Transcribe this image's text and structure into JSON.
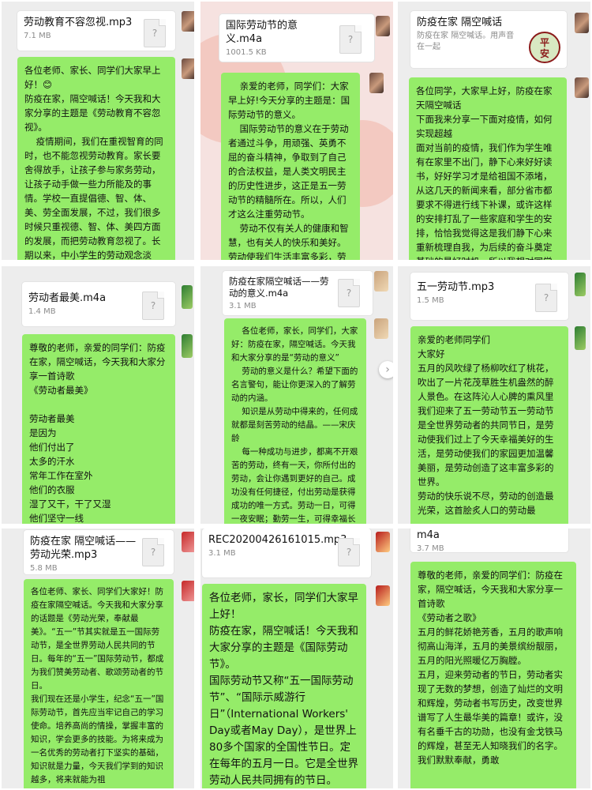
{
  "panels": [
    {
      "file_name": "劳动教育不容忽视.mp3",
      "file_size": "7.1 MB",
      "bubble": "各位老师、家长、同学们大家早上好！😊\n防疫在家，隔空喊话！今天我和大家分享的主题是《劳动教育不容忽视》。\n    疫情期间，我们在重视智育的同时，也不能忽视劳动教育。家长要舍得放手，让孩子参与家务劳动，让孩子动手做一些力所能及的事情。学校一直提倡德、智、体、美、劳全面发展，不过，我们很多时候只重视德、智、体、美四方面的发展，而把劳动教育忽视了。长期以来，中小学生的劳动观念淡薄，劳动技能较低，"
    },
    {
      "file_name": "国际劳动节的意义.m4a",
      "file_size": "1001.5 KB",
      "bubble": "    亲爱的老师，同学们：大家早上好!今天分享的主题是：国际劳动节的意义。\n    国际劳动节的意义在于劳动者通过斗争，用顽强、英勇不屈的奋斗精神，争取到了自己的合法权益，是人类文明民主的历史性进步，这正是五一劳动节的精髓所在。所以，人们才这么注重劳动节。\n    劳动不仅有关人的健康和智慧，也有关人的快乐和美好。劳动使我们生活丰富多彩，劳动"
    },
    {
      "file_name": "防疫在家 隔空喊话",
      "file_desc": "防疫在家 隔空喊话。用声音在一起",
      "thumb_text": "平\n安",
      "bubble": "各位同学，大家早上好，防疫在家\n天隔空喊话\n下面我来分享一下面对疫情，如何实现超越\n面对当前的疫情，我们作为学生唯有在家里不出门，静下心来好好读书，好好学习才是给祖国不添堵，从这几天的新闻来看，部分省市都要求不得进行线下补课，或许这样的安排打乱了一些家庭和学生的安排，恰恰我觉得这是我们静下心来重新梳理自我，为后续的奋斗奠定基础的最好时机，所以我想对同学"
    },
    {
      "file_name": "劳动者最美.m4a",
      "file_size": "1.4 MB",
      "bubble": "尊敬的老师，亲爱的同学们：防疫在家，隔空喊话，今天我和大家分享一首诗歌\n《劳动者最美》\n\n劳动者最美\n是因为\n他们付出了\n太多的汗水\n常年工作在室外\n他们的衣服\n湿了又干，干了又湿\n他们坚守一线\n无论刮风下雨"
    },
    {
      "file_name": "防疫在家隔空喊话——劳动的意义.m4a",
      "file_size": "3.1 MB",
      "bubble": "    各位老师，家长，同学们，大家好：防疫在家，隔空喊话。今天我和大家分享的是“劳动的意义”\n    劳动的意义是什么？希望下面的名言警句，能让你更深入的了解劳动的内涵。\n    知识是从劳动中得来的，任何成就都是刻苦劳动的结晶。——宋庆龄\n    每一种成功与进步，都离不开艰苦的劳动，终有一天，你所付出的劳动，会让你遇到更好的自己。成功没有任何捷径，付出劳动是获得成功的唯一方式。劳动一日，可得一夜安眠；勤劳一生，可得幸福长眠。——达芬奇\n    才成伟，不能"
    },
    {
      "file_name": "五一劳动节.mp3",
      "file_size": "1.5 MB",
      "bubble": "亲爱的老师同学们\n大家好\n五月的风吹绿了杨柳吹红了桃花，吹出了一片花茂草胜生机盎然的醉人景色。在这阵沁人心脾的熏风里我们迎来了五一劳动节五一劳动节是全世界劳动者的共同节日，是劳动使我们过上了今天幸福美好的生活，是劳动使我们的家园更加温馨美丽，是劳动创造了这丰富多彩的世界。\n劳动的快乐说不尽，劳动的创造最光荣，这首脍炙人口的劳动最"
    },
    {
      "file_name": "防疫在家  隔空喊话——劳动光荣.mp3",
      "file_size": "5.8 MB",
      "bubble": "各位老师、家长、同学们大家好！防疫在家隔空喊话。今天我和大家分享的话题是《劳动光荣，奉献最美》。“五一”节其实就是五一国际劳动节，是全世界劳动人民共同的节日。每年的“五一”国际劳动节，都成为我们赞美劳动者、歌颂劳动者的节日。\n我们现在还是小学生，纪念“五一”国际劳动节，首先应当牢记自己的学习使命。培养高尚的情操，掌握丰富的知识，学会更多的技能。为将来成为一名优秀的劳动者打下坚实的基础，知识就是力量，今天我们学到的知识越多，将来就能为祖"
    },
    {
      "file_name": "REC20200426161015.mp3",
      "file_size": "3.1 MB",
      "bubble": "各位老师，家长，同学们大家早上好！\n防疫在家，隔空喊话！今天我和大家分享的主题是《国际劳动节》。\n国际劳动节又称“五一国际劳动节”、“国际示威游行日”（International Workers' Day或者May Day），是世界上80多个国家的全国性节日。定在每年的五月一日。它是全世界劳动人民共同拥有的节日。"
    },
    {
      "file_name": "m4a",
      "file_size": "3.7 MB",
      "bubble": "尊敬的老师，亲爱的同学们：防疫在家，隔空喊话，今天我和大家分享一首诗歌\n《劳动者之歌》\n五月的鲜花娇艳芳香，五月的歌声响彻高山海洋，五月的美景缤纷靓丽，五月的阳光照暖亿万胸膛。\n五月，迎来劳动者的节日，劳动者实现了无数的梦想，创造了灿烂的文明和辉煌，劳动者书写历史，改变世界谱写了人生最华美的篇章！或许，没有名垂千古的功勋，也没有金戈铁马的辉煌，甚至无人知晓我们的名字。我们默默奉献，勇敢"
    }
  ]
}
